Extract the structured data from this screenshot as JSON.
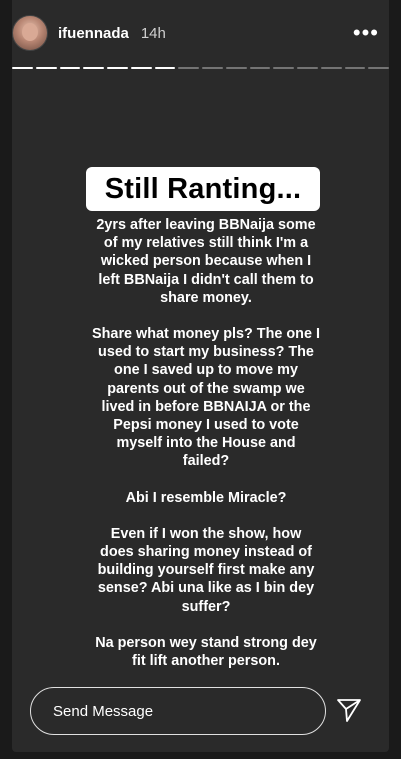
{
  "header": {
    "username": "ifuennada",
    "time": "14h",
    "more_icon": "more-horizontal-icon"
  },
  "progress": {
    "total_segments": 16,
    "completed_segments": 7
  },
  "story": {
    "title": "Still Ranting...",
    "paragraphs": [
      "2yrs after leaving BBNaija some of my relatives still think I'm a wicked person because when I left BBNaija I didn't call them to share money.",
      "Share what money pls? The one I used to start my business? The one I saved up to move my parents out of the swamp we lived in before BBNAIJA or the Pepsi money I used to vote myself into the House and failed?",
      "Abi I resemble Miracle?",
      "Even if I won the show, how does sharing money instead of building yourself first make any sense? Abi una like as I bin dey suffer?",
      "Na person wey stand strong dey fit lift another person."
    ]
  },
  "footer": {
    "message_placeholder": "Send Message",
    "send_icon": "send-paper-plane-icon"
  }
}
